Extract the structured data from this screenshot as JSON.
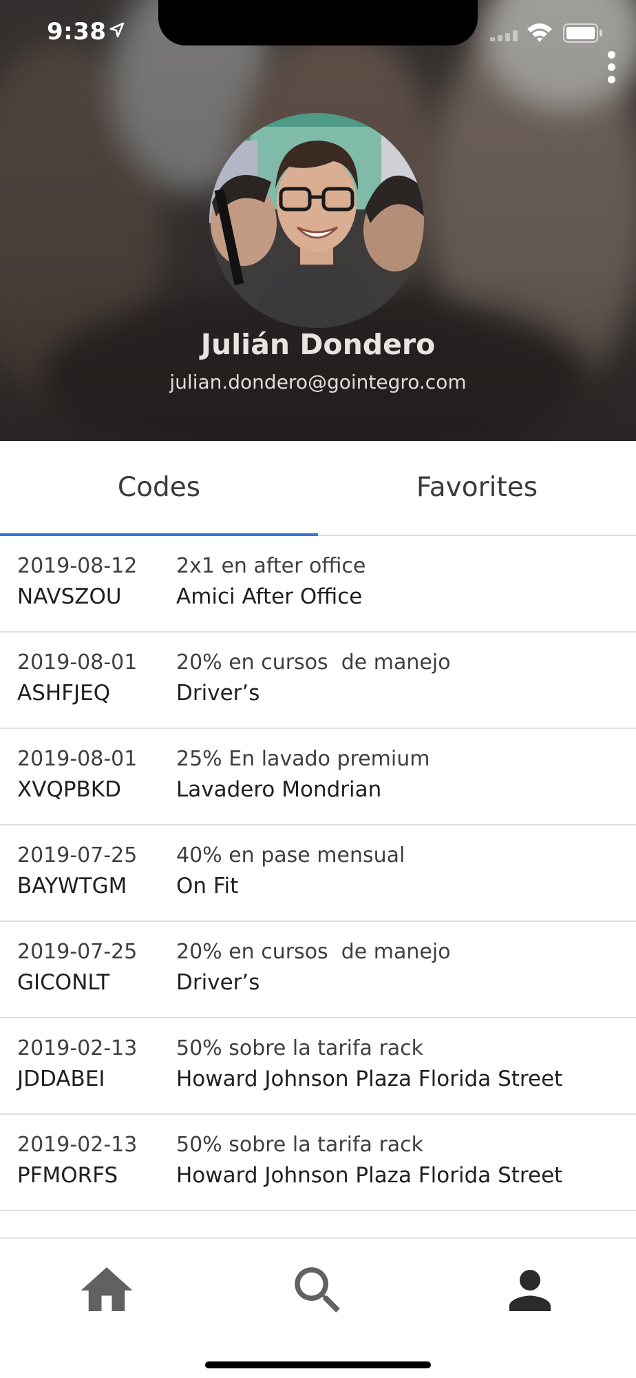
{
  "status_bar": {
    "time": "9:38"
  },
  "profile": {
    "name": "Julián Dondero",
    "email": "julian.dondero@gointegro.com"
  },
  "tabs": [
    {
      "label": "Codes",
      "selected": true
    },
    {
      "label": "Favorites",
      "selected": false
    }
  ],
  "codes": [
    {
      "date": "2019-08-12",
      "code": "NAVSZOU",
      "benefit": "2x1 en after office",
      "merchant": "Amici After Office"
    },
    {
      "date": "2019-08-01",
      "code": "ASHFJEQ",
      "benefit": "20% en cursos  de manejo",
      "merchant": "Driver’s"
    },
    {
      "date": "2019-08-01",
      "code": "XVQPBKD",
      "benefit": "25% En lavado premium",
      "merchant": "Lavadero Mondrian"
    },
    {
      "date": "2019-07-25",
      "code": "BAYWTGM",
      "benefit": "40% en pase mensual",
      "merchant": "On Fit"
    },
    {
      "date": "2019-07-25",
      "code": "GICONLT",
      "benefit": "20% en cursos  de manejo",
      "merchant": "Driver’s"
    },
    {
      "date": "2019-02-13",
      "code": "JDDABEI",
      "benefit": "50% sobre la tarifa rack",
      "merchant": "Howard Johnson Plaza Florida Street"
    },
    {
      "date": "2019-02-13",
      "code": "PFMORFS",
      "benefit": "50% sobre la tarifa rack",
      "merchant": "Howard Johnson Plaza Florida Street"
    }
  ],
  "bottom_nav": [
    {
      "icon": "home-icon"
    },
    {
      "icon": "search-icon"
    },
    {
      "icon": "person-icon"
    }
  ],
  "colors": {
    "accent": "#2f7ad6",
    "nav_icon": "#616161"
  }
}
